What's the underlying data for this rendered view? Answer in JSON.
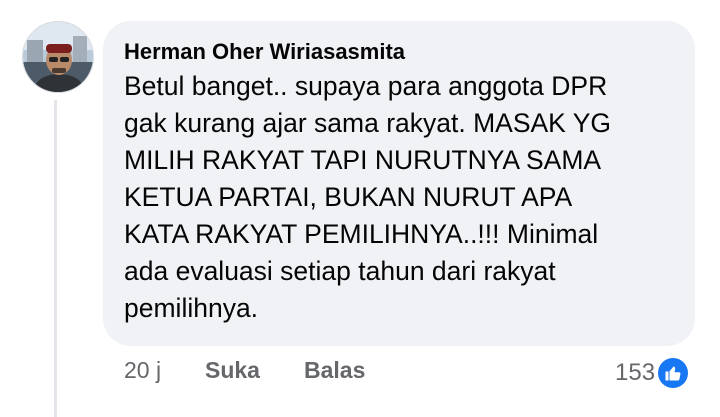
{
  "comment": {
    "author": "Herman Oher Wiriasasmita",
    "text": "Betul banget.. supaya para anggota DPR\ngak kurang ajar sama rakyat. MASAK YG\nMILIH RAKYAT TAPI NURUTNYA SAMA\nKETUA PARTAI, BUKAN NURUT APA\nKATA RAKYAT PEMILIHNYA..!!! Minimal\nada evaluasi setiap tahun dari rakyat\npemilihnya.",
    "time": "20 j",
    "like_label": "Suka",
    "reply_label": "Balas",
    "reaction_count": "153"
  },
  "colors": {
    "bubble": "#f0f2f5",
    "muted_text": "#65676b",
    "like_blue": "#1877f2"
  },
  "icons": {
    "reaction": "thumbs-up-icon"
  }
}
